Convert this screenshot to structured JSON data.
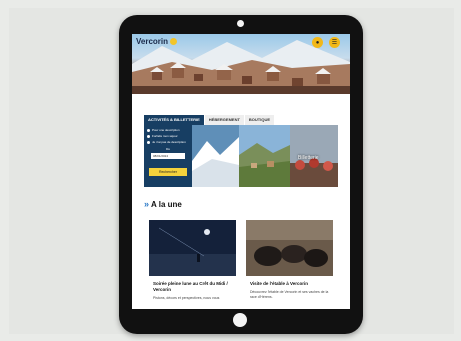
{
  "header": {
    "logo_text": "Verc",
    "logo_text_suffix": "orin",
    "icons": [
      "user-icon",
      "menu-icon"
    ]
  },
  "tabs": [
    {
      "label": "ACTIVITÉS & BILLETTERIE",
      "active": true
    },
    {
      "label": "HÉBERGEMENT",
      "active": false
    },
    {
      "label": "BOUTIQUE",
      "active": false
    }
  ],
  "booking": {
    "options": [
      "Pour une description",
      "Forfaits mon séjour",
      "Je n'ai pas de description"
    ],
    "date_label": "Du",
    "date_value": "08/01/2024",
    "button_label": "Rechercher"
  },
  "photos": [
    {
      "label": ""
    },
    {
      "label": ""
    },
    {
      "label": "Billetterie"
    }
  ],
  "section": {
    "title": "A la une"
  },
  "cards": [
    {
      "title": "Soirée pleine lune au Crêt du Midi / Vercorin",
      "description": "Pistons, décors et perspectives, nous vous"
    },
    {
      "title": "Visite de l'étable à Vercorin",
      "description": "Découvrez l'étable de Vercorin et ses vaches de la race d'Hérens."
    }
  ],
  "colors": {
    "brand_navy": "#173e63",
    "accent_yellow": "#f4d23c",
    "section_arrow": "#2c7ac7"
  }
}
